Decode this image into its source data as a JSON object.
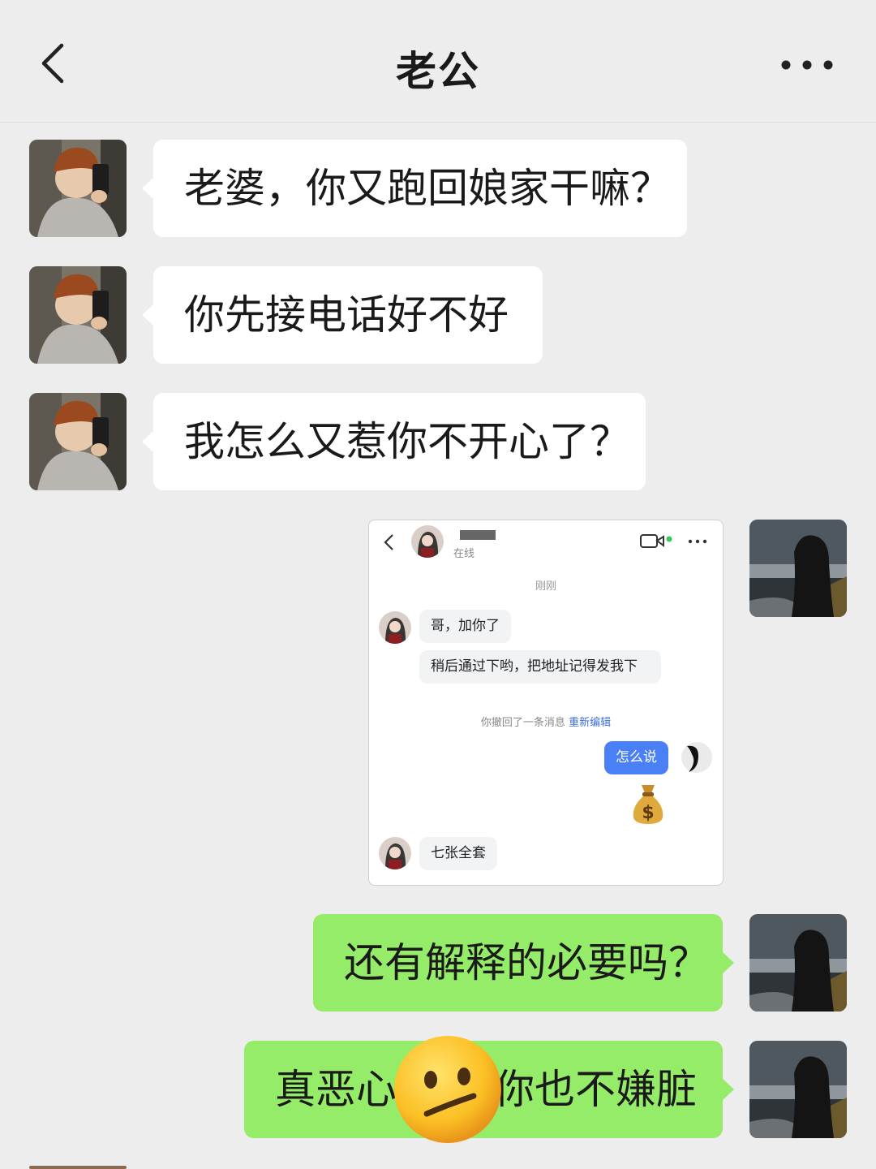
{
  "header": {
    "title": "老公",
    "back_icon": "chevron-left-icon",
    "more_icon": "more-horizontal-icon"
  },
  "messages": [
    {
      "side": "left",
      "text": "老婆，你又跑回娘家干嘛？"
    },
    {
      "side": "left",
      "text": "你先接电话好不好"
    },
    {
      "side": "left",
      "text": "我怎么又惹你不开心了？"
    },
    {
      "side": "right",
      "type": "image"
    },
    {
      "side": "right",
      "text": "还有解释的必要吗？"
    },
    {
      "side": "right",
      "text": "真恶心你也不嫌脏",
      "text_before_emoji": "真恶心",
      "text_after_emoji": "你也不嫌脏",
      "emoji": "neutral-face-emoji"
    }
  ],
  "screenshot": {
    "status": "在线",
    "time": "刚刚",
    "msg1": "哥，加你了",
    "msg2": "稍后通过下哟，把地址记得发我下",
    "recall_notice": "你撤回了一条消息",
    "reedit_link": "重新编辑",
    "my_msg": "怎么说",
    "emoji": "money-bag-icon",
    "msg3": "七张全套",
    "colors": {
      "my_bubble": "#4a80f5",
      "link": "#3f6fd8",
      "online_dot": "#35c759"
    }
  },
  "colors": {
    "background": "#ededed",
    "left_bubble": "#ffffff",
    "right_bubble": "#95ec69"
  }
}
